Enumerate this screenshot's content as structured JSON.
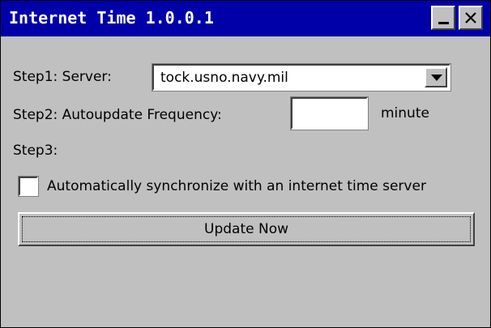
{
  "window": {
    "title": "Internet Time 1.0.0.1"
  },
  "titlebar_buttons": {
    "minimize_icon": "minimize-icon",
    "close_icon": "close-icon"
  },
  "step1": {
    "label": "Step1: Server:",
    "server_value": "tock.usno.navy.mil",
    "dropdown_icon": "chevron-down-icon"
  },
  "step2": {
    "label": "Step2: Autoupdate Frequency:",
    "frequency_value": "",
    "unit": "minute"
  },
  "step3": {
    "label": "Step3:",
    "auto_sync_label": "Automatically synchronize with an internet time server",
    "auto_sync_checked": false
  },
  "update_button": {
    "label": "Update Now"
  }
}
